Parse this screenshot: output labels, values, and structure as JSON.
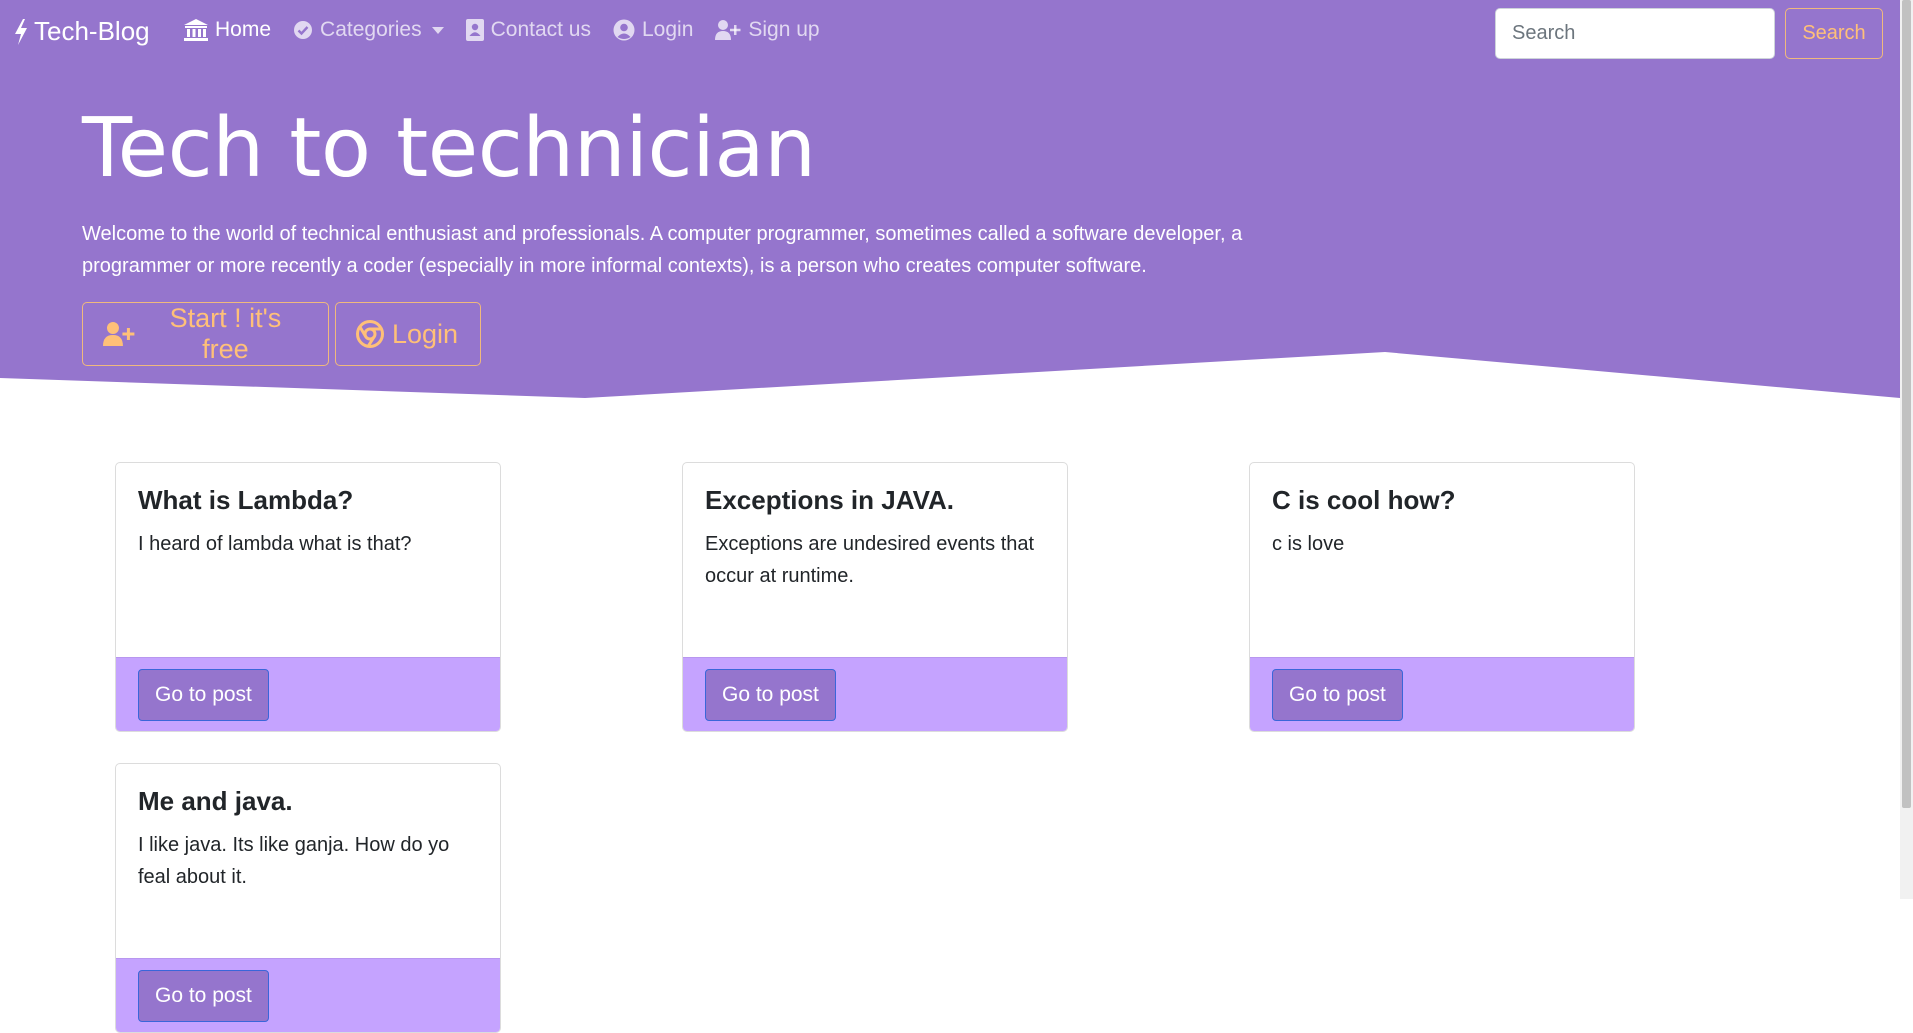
{
  "colors": {
    "hero": "#9575cd",
    "accent": "#ffc078",
    "card_footer": "#c5a3ff",
    "post_button": "#9575cd"
  },
  "navbar": {
    "brand": "Tech-Blog",
    "brand_icon": "bolt-icon",
    "items": [
      {
        "label": "Home",
        "icon": "bank-icon",
        "active": true
      },
      {
        "label": "Categories",
        "icon": "check-circle-icon",
        "dropdown": true
      },
      {
        "label": "Contact us",
        "icon": "address-book-icon"
      },
      {
        "label": "Login",
        "icon": "user-circle-icon"
      },
      {
        "label": "Sign up",
        "icon": "user-plus-icon"
      }
    ],
    "search_placeholder": "Search",
    "search_button": "Search"
  },
  "hero": {
    "title": "Tech to technician",
    "text": "Welcome to the world of technical enthusiast and professionals. A computer programmer, sometimes called a software developer, a programmer or more recently a coder (especially in more informal contexts), is a person who creates computer software.",
    "start_button": "Start ! it's free",
    "start_icon": "user-plus-icon",
    "login_button": "Login",
    "login_icon": "chrome-icon"
  },
  "posts": [
    {
      "title": "What is Lambda?",
      "text": "I heard of lambda what is that?",
      "button": "Go to post"
    },
    {
      "title": "Exceptions in JAVA.",
      "text": "Exceptions are undesired events that occur at runtime.",
      "button": "Go to post"
    },
    {
      "title": "C is cool how?",
      "text": "c is love",
      "button": "Go to post"
    },
    {
      "title": "Me and java.",
      "text": "I like java. Its like ganja. How do yo feal about it.",
      "button": "Go to post"
    }
  ]
}
